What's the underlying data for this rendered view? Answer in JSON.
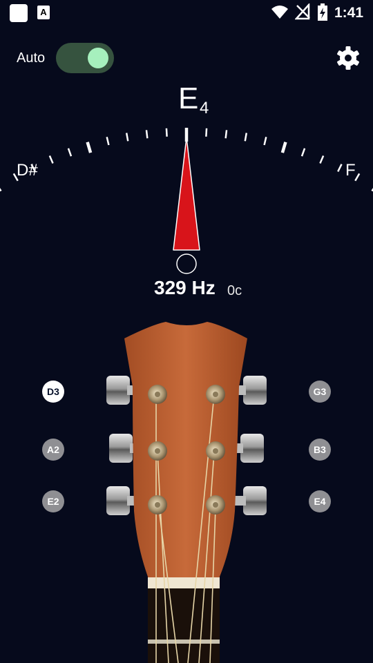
{
  "status_bar": {
    "time": "1:41",
    "icons": [
      "app-square-icon",
      "font-a-icon",
      "wifi-icon",
      "no-signal-icon",
      "battery-charging-icon"
    ]
  },
  "toolbar": {
    "auto_label": "Auto",
    "auto_enabled": true,
    "settings_icon": "gear-icon"
  },
  "tuner": {
    "note": "E",
    "octave": "4",
    "left_note": "D#",
    "right_note": "F",
    "frequency": "329 Hz",
    "cents": "0c"
  },
  "strings": {
    "left": [
      {
        "label": "D3",
        "active": true
      },
      {
        "label": "A2",
        "active": false
      },
      {
        "label": "E2",
        "active": false
      }
    ],
    "right": [
      {
        "label": "G3",
        "active": false
      },
      {
        "label": "B3",
        "active": false
      },
      {
        "label": "E4",
        "active": false
      }
    ]
  },
  "colors": {
    "background": "#060a1c",
    "toggle_track": "#36533f",
    "toggle_knob": "#a6f0bd",
    "needle": "#d8141a",
    "wood": "#b45a2e",
    "inactive_button": "#8f8f93"
  }
}
